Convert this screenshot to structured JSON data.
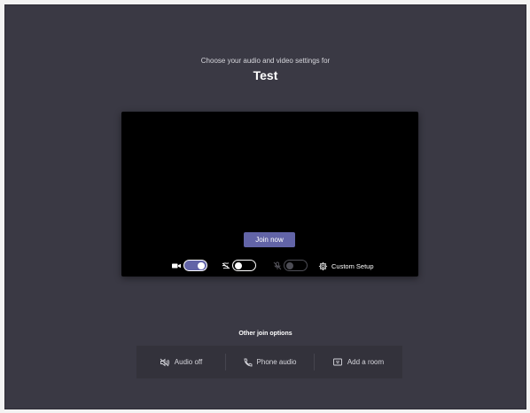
{
  "header": {
    "subtitle": "Choose your audio and video settings for",
    "meeting_name": "Test"
  },
  "preview": {
    "join_label": "Join now",
    "controls": {
      "camera": {
        "state": "on",
        "icon": "video-camera-icon"
      },
      "background_blur": {
        "state": "off",
        "icon": "background-blur-icon"
      },
      "microphone": {
        "state": "disabled",
        "icon": "microphone-off-icon"
      },
      "custom_setup_label": "Custom Setup",
      "custom_setup_icon": "gear-icon"
    }
  },
  "other_options": {
    "label": "Other join options",
    "items": [
      {
        "label": "Audio off",
        "icon": "speaker-off-icon"
      },
      {
        "label": "Phone audio",
        "icon": "phone-icon"
      },
      {
        "label": "Add a room",
        "icon": "room-display-icon"
      }
    ]
  },
  "colors": {
    "background": "#3a3944",
    "accent": "#6264a7",
    "preview": "#000000",
    "options_panel": "#33323b"
  }
}
